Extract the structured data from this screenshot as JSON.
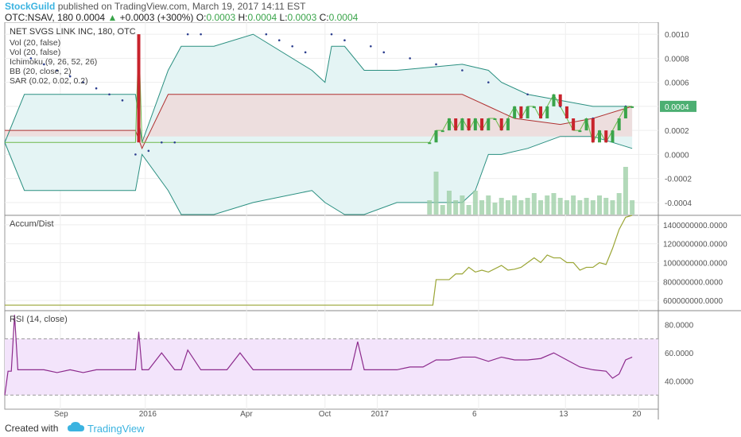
{
  "header": {
    "brand": "StockGuild",
    "published_text": "published on TradingView.com, March 19, 2017 14:11 EST",
    "symbol_text": "OTC:NSAV, 180",
    "last": "0.0004",
    "change": "+0.0003 (+300%)",
    "open_label": "O:",
    "open": "0.0003",
    "high_label": "H:",
    "high": "0.0004",
    "low_label": "L:",
    "low": "0.0003",
    "close_label": "C:",
    "close": "0.0004"
  },
  "colors": {
    "up": "#3aa44a",
    "down": "#c8232c",
    "brand": "#3bb3e0",
    "ichimoku_cloud_up": "#f4cccc",
    "ichimoku_cloud_down": "#d3ecd3",
    "bb_fill": "#e4f4f4",
    "rsi_band": "#f3e4fb",
    "accdist_line": "#9aa534",
    "rsi_line": "#8c2a8c",
    "price_axis_label": "#4caf72"
  },
  "footer": {
    "created_with": "Created with",
    "logo": "TradingView",
    "logo_icon": "cloud-icon"
  },
  "chart_data": [
    {
      "id": "price",
      "type": "line",
      "title": "NET SVGS LINK INC, 180, OTC",
      "indicators": [
        "Vol (20, false)",
        "Vol (20, false)",
        "Ichimoku (9, 26, 52, 26)",
        "BB (20, close, 2)",
        "SAR (0.02, 0.02, 0.2)"
      ],
      "ylim": [
        -0.0005,
        0.0011
      ],
      "yticks": [
        "0.0010",
        "0.0008",
        "0.0006",
        "0.0004",
        "0.0002",
        "0.0000",
        "-0.0002",
        "-0.0004"
      ],
      "ytick_values": [
        0.001,
        0.0008,
        0.0006,
        0.0004,
        0.0002,
        0.0,
        -0.0002,
        -0.0004
      ],
      "last_price_label": "0.0004",
      "last_price": 0.0004,
      "xlabels": [
        "Sep",
        "2016",
        "Apr",
        "Oct",
        "2017",
        "6",
        "13",
        "20"
      ],
      "xlabel_pos": [
        0.085,
        0.215,
        0.37,
        0.49,
        0.57,
        0.725,
        0.858,
        0.97
      ],
      "series": [
        {
          "role": "close",
          "x": [
            0,
            0.02,
            0.04,
            0.06,
            0.08,
            0.1,
            0.12,
            0.14,
            0.16,
            0.18,
            0.2,
            0.205,
            0.21,
            0.215,
            0.22,
            0.25,
            0.27,
            0.29,
            0.31,
            0.33,
            0.35,
            0.37,
            0.39,
            0.41,
            0.43,
            0.45,
            0.47,
            0.49,
            0.51,
            0.53,
            0.55,
            0.57,
            0.59,
            0.61,
            0.63,
            0.65,
            0.66,
            0.67,
            0.68,
            0.69,
            0.7,
            0.71,
            0.72,
            0.73,
            0.74,
            0.75,
            0.76,
            0.77,
            0.78,
            0.79,
            0.8,
            0.81,
            0.82,
            0.83,
            0.84,
            0.85,
            0.86,
            0.87,
            0.88,
            0.89,
            0.9,
            0.91,
            0.92,
            0.93,
            0.94,
            0.95,
            0.96
          ],
          "values": [
            0.0001,
            0.0001,
            0.0001,
            0.0001,
            0.0001,
            0.0001,
            0.0001,
            0.0001,
            0.0001,
            0.0001,
            0.0001,
            0.001,
            0.0001,
            0.0001,
            0.0001,
            0.0001,
            0.0001,
            0.0001,
            0.0001,
            0.0001,
            0.0001,
            0.0001,
            0.0001,
            0.0001,
            0.0001,
            0.0001,
            0.0001,
            0.0001,
            0.0001,
            0.0001,
            0.0001,
            0.0001,
            0.0001,
            0.0001,
            0.0001,
            0.0001,
            0.0002,
            0.0002,
            0.0003,
            0.0002,
            0.0003,
            0.0002,
            0.0003,
            0.0002,
            0.0003,
            0.0003,
            0.0002,
            0.0003,
            0.0004,
            0.0003,
            0.0004,
            0.0004,
            0.0003,
            0.0004,
            0.0005,
            0.0004,
            0.0003,
            0.0002,
            0.0002,
            0.0003,
            0.0001,
            0.0002,
            0.0001,
            0.0002,
            0.0003,
            0.0004,
            0.0004
          ]
        },
        {
          "role": "bb_upper",
          "x": [
            0,
            0.03,
            0.2,
            0.21,
            0.25,
            0.27,
            0.32,
            0.38,
            0.47,
            0.49,
            0.5,
            0.52,
            0.55,
            0.6,
            0.7,
            0.74,
            0.76,
            0.8,
            0.9,
            0.96
          ],
          "values": [
            0.0001,
            0.0005,
            0.0005,
            0.0001,
            0.0007,
            0.0009,
            0.0009,
            0.001,
            0.0007,
            0.0006,
            0.0009,
            0.0009,
            0.0007,
            0.0007,
            0.00075,
            0.0007,
            0.0006,
            0.0005,
            0.0004,
            0.0004
          ]
        },
        {
          "role": "bb_lower",
          "x": [
            0,
            0.03,
            0.2,
            0.21,
            0.25,
            0.27,
            0.32,
            0.38,
            0.47,
            0.49,
            0.52,
            0.55,
            0.6,
            0.7,
            0.72,
            0.74,
            0.76,
            0.8,
            0.85,
            0.9,
            0.96
          ],
          "values": [
            0.0001,
            -0.0003,
            -0.0003,
            0.0,
            -0.0003,
            -0.0005,
            -0.0005,
            -0.0004,
            -0.0003,
            -0.0004,
            -0.0005,
            -0.0005,
            -0.0004,
            -0.0004,
            -0.0003,
            0.0,
            0.0,
            5e-05,
            0.00015,
            0.00015,
            5e-05
          ]
        },
        {
          "role": "ichimoku_span",
          "x": [
            0,
            0.02,
            0.2,
            0.21,
            0.25,
            0.4,
            0.45,
            0.55,
            0.6,
            0.7,
            0.74,
            0.78,
            0.85,
            0.9,
            0.96
          ],
          "values": [
            0.0002,
            0.0002,
            0.0002,
            5e-05,
            0.0005,
            0.0005,
            0.0005,
            0.0005,
            0.0005,
            0.0005,
            0.0004,
            0.0003,
            0.00025,
            0.0003,
            0.0004
          ]
        },
        {
          "role": "sar",
          "x": [
            0.04,
            0.06,
            0.08,
            0.1,
            0.12,
            0.14,
            0.16,
            0.18,
            0.2,
            0.22,
            0.24,
            0.26,
            0.28,
            0.3,
            0.4,
            0.42,
            0.44,
            0.46,
            0.5,
            0.52,
            0.56,
            0.58,
            0.62,
            0.66,
            0.7,
            0.74,
            0.8,
            0.85,
            0.9,
            0.95
          ],
          "values": [
            0.0008,
            0.00075,
            0.0007,
            0.00065,
            0.0006,
            0.00055,
            0.0005,
            0.00045,
            0.0,
            3e-05,
            0.0001,
            0.0001,
            0.001,
            0.001,
            0.001,
            0.00095,
            0.0009,
            0.00085,
            0.001,
            0.00095,
            0.0009,
            0.00085,
            0.0008,
            0.00075,
            0.0007,
            0.0006,
            0.0005,
            0.0004,
            0.0003,
            0.0004
          ]
        }
      ],
      "volume": {
        "x": [
          0.65,
          0.66,
          0.67,
          0.68,
          0.69,
          0.7,
          0.71,
          0.72,
          0.73,
          0.74,
          0.75,
          0.76,
          0.77,
          0.78,
          0.79,
          0.8,
          0.81,
          0.82,
          0.83,
          0.84,
          0.85,
          0.86,
          0.87,
          0.88,
          0.89,
          0.9,
          0.91,
          0.92,
          0.93,
          0.94,
          0.95,
          0.96
        ],
        "values": [
          0.3,
          0.9,
          0.2,
          0.5,
          0.3,
          0.4,
          0.2,
          0.5,
          0.3,
          0.4,
          0.25,
          0.35,
          0.3,
          0.4,
          0.3,
          0.35,
          0.45,
          0.3,
          0.4,
          0.45,
          0.35,
          0.3,
          0.4,
          0.3,
          0.35,
          0.3,
          0.4,
          0.35,
          0.3,
          0.45,
          1.0,
          0.3
        ]
      }
    },
    {
      "id": "accdist",
      "type": "line",
      "title": "Accum/Dist",
      "ylim": [
        500000000,
        1500000000
      ],
      "yticks": [
        "1400000000.0000",
        "1200000000.0000",
        "1000000000.0000",
        "800000000.0000",
        "600000000.0000"
      ],
      "ytick_values": [
        1400000000,
        1200000000,
        1000000000,
        800000000,
        600000000
      ],
      "x": [
        0,
        0.3,
        0.5,
        0.6,
        0.655,
        0.66,
        0.68,
        0.69,
        0.7,
        0.71,
        0.72,
        0.73,
        0.74,
        0.76,
        0.77,
        0.78,
        0.79,
        0.8,
        0.81,
        0.82,
        0.83,
        0.84,
        0.85,
        0.86,
        0.87,
        0.88,
        0.89,
        0.9,
        0.91,
        0.92,
        0.93,
        0.94,
        0.95,
        0.96
      ],
      "values": [
        550000000,
        550000000,
        550000000,
        550000000,
        550000000,
        820000000,
        820000000,
        880000000,
        880000000,
        950000000,
        900000000,
        920000000,
        900000000,
        970000000,
        920000000,
        930000000,
        950000000,
        1000000000,
        1050000000,
        1000000000,
        1080000000,
        1050000000,
        1050000000,
        1000000000,
        1000000000,
        920000000,
        950000000,
        950000000,
        1000000000,
        980000000,
        1150000000,
        1350000000,
        1480000000,
        1500000000
      ]
    },
    {
      "id": "rsi",
      "type": "line",
      "title": "RSI (14, close)",
      "ylim": [
        20,
        90
      ],
      "yticks": [
        "80.0000",
        "60.0000",
        "40.0000"
      ],
      "ytick_values": [
        80,
        60,
        40
      ],
      "band": [
        30,
        70
      ],
      "x": [
        0,
        0.005,
        0.01,
        0.015,
        0.02,
        0.025,
        0.03,
        0.035,
        0.04,
        0.06,
        0.08,
        0.1,
        0.12,
        0.14,
        0.16,
        0.18,
        0.19,
        0.2,
        0.205,
        0.21,
        0.22,
        0.24,
        0.26,
        0.27,
        0.28,
        0.3,
        0.32,
        0.34,
        0.36,
        0.38,
        0.4,
        0.42,
        0.44,
        0.46,
        0.48,
        0.5,
        0.52,
        0.53,
        0.54,
        0.55,
        0.56,
        0.58,
        0.6,
        0.62,
        0.64,
        0.66,
        0.68,
        0.7,
        0.72,
        0.74,
        0.76,
        0.78,
        0.8,
        0.82,
        0.84,
        0.86,
        0.88,
        0.9,
        0.92,
        0.93,
        0.94,
        0.95,
        0.96
      ],
      "values": [
        30,
        47,
        47,
        87,
        48,
        48,
        48,
        48,
        48,
        48,
        46,
        48,
        46,
        48,
        48,
        48,
        48,
        48,
        75,
        48,
        48,
        60,
        48,
        48,
        62,
        48,
        48,
        48,
        60,
        48,
        48,
        48,
        48,
        48,
        48,
        48,
        48,
        48,
        68,
        48,
        48,
        48,
        48,
        50,
        50,
        55,
        55,
        57,
        57,
        54,
        57,
        55,
        55,
        56,
        60,
        55,
        50,
        48,
        47,
        42,
        45,
        55,
        57
      ]
    }
  ]
}
